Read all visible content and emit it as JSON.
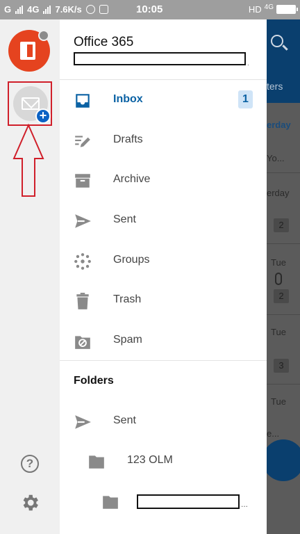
{
  "status_bar": {
    "carrier_1": "G",
    "carrier_2": "4G",
    "speed": "7.6K/s",
    "time": "10:05",
    "right_label": "HD",
    "right_network": "4G"
  },
  "background": {
    "filters": "ters",
    "date_1": "erday",
    "snippet": "Yo...",
    "date_2": "erday",
    "count_1": "2",
    "date_3": "Tue",
    "count_2": "2",
    "date_4": "Tue",
    "count_3": "3",
    "date_5": "Tue",
    "snippet_2": "e..."
  },
  "rail": {
    "help_icon": "?"
  },
  "account": {
    "name": "Office 365",
    "ellipsis": "."
  },
  "nav": [
    {
      "label": "Inbox",
      "badge": "1"
    },
    {
      "label": "Drafts"
    },
    {
      "label": "Archive"
    },
    {
      "label": "Sent"
    },
    {
      "label": "Groups"
    },
    {
      "label": "Trash"
    },
    {
      "label": "Spam"
    }
  ],
  "folders": {
    "title": "Folders",
    "items": [
      {
        "label": "Sent"
      },
      {
        "label": "123 OLM"
      },
      {
        "label": "",
        "ellipsis": "..."
      }
    ]
  },
  "colors": {
    "accent": "#0b62a4",
    "office_red": "#e5431f",
    "highlight_red": "#d01f2a"
  }
}
